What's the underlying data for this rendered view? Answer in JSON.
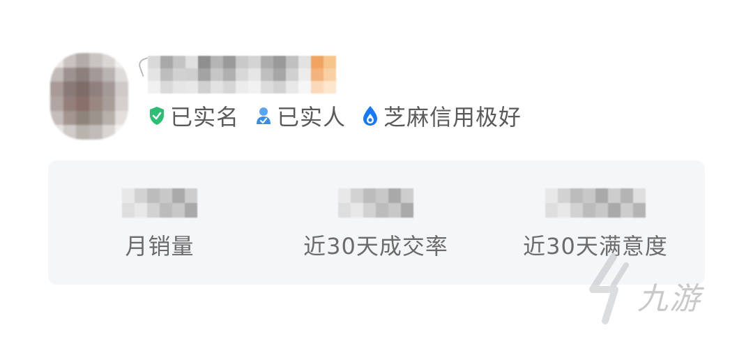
{
  "profile": {
    "verifications": [
      {
        "label": "已实名",
        "icon": "shield-check-icon",
        "color": "#2dbd73"
      },
      {
        "label": "已实人",
        "icon": "person-check-icon",
        "color": "#3a8ee6"
      },
      {
        "label": "芝麻信用极好",
        "icon": "zhima-drop-icon",
        "color": "#1677ff"
      }
    ]
  },
  "stats": [
    {
      "label": "月销量"
    },
    {
      "label": "近30天成交率"
    },
    {
      "label": "近30天满意度"
    }
  ],
  "watermark": {
    "text": "九游",
    "icon": "jiuyou-logo-icon"
  }
}
